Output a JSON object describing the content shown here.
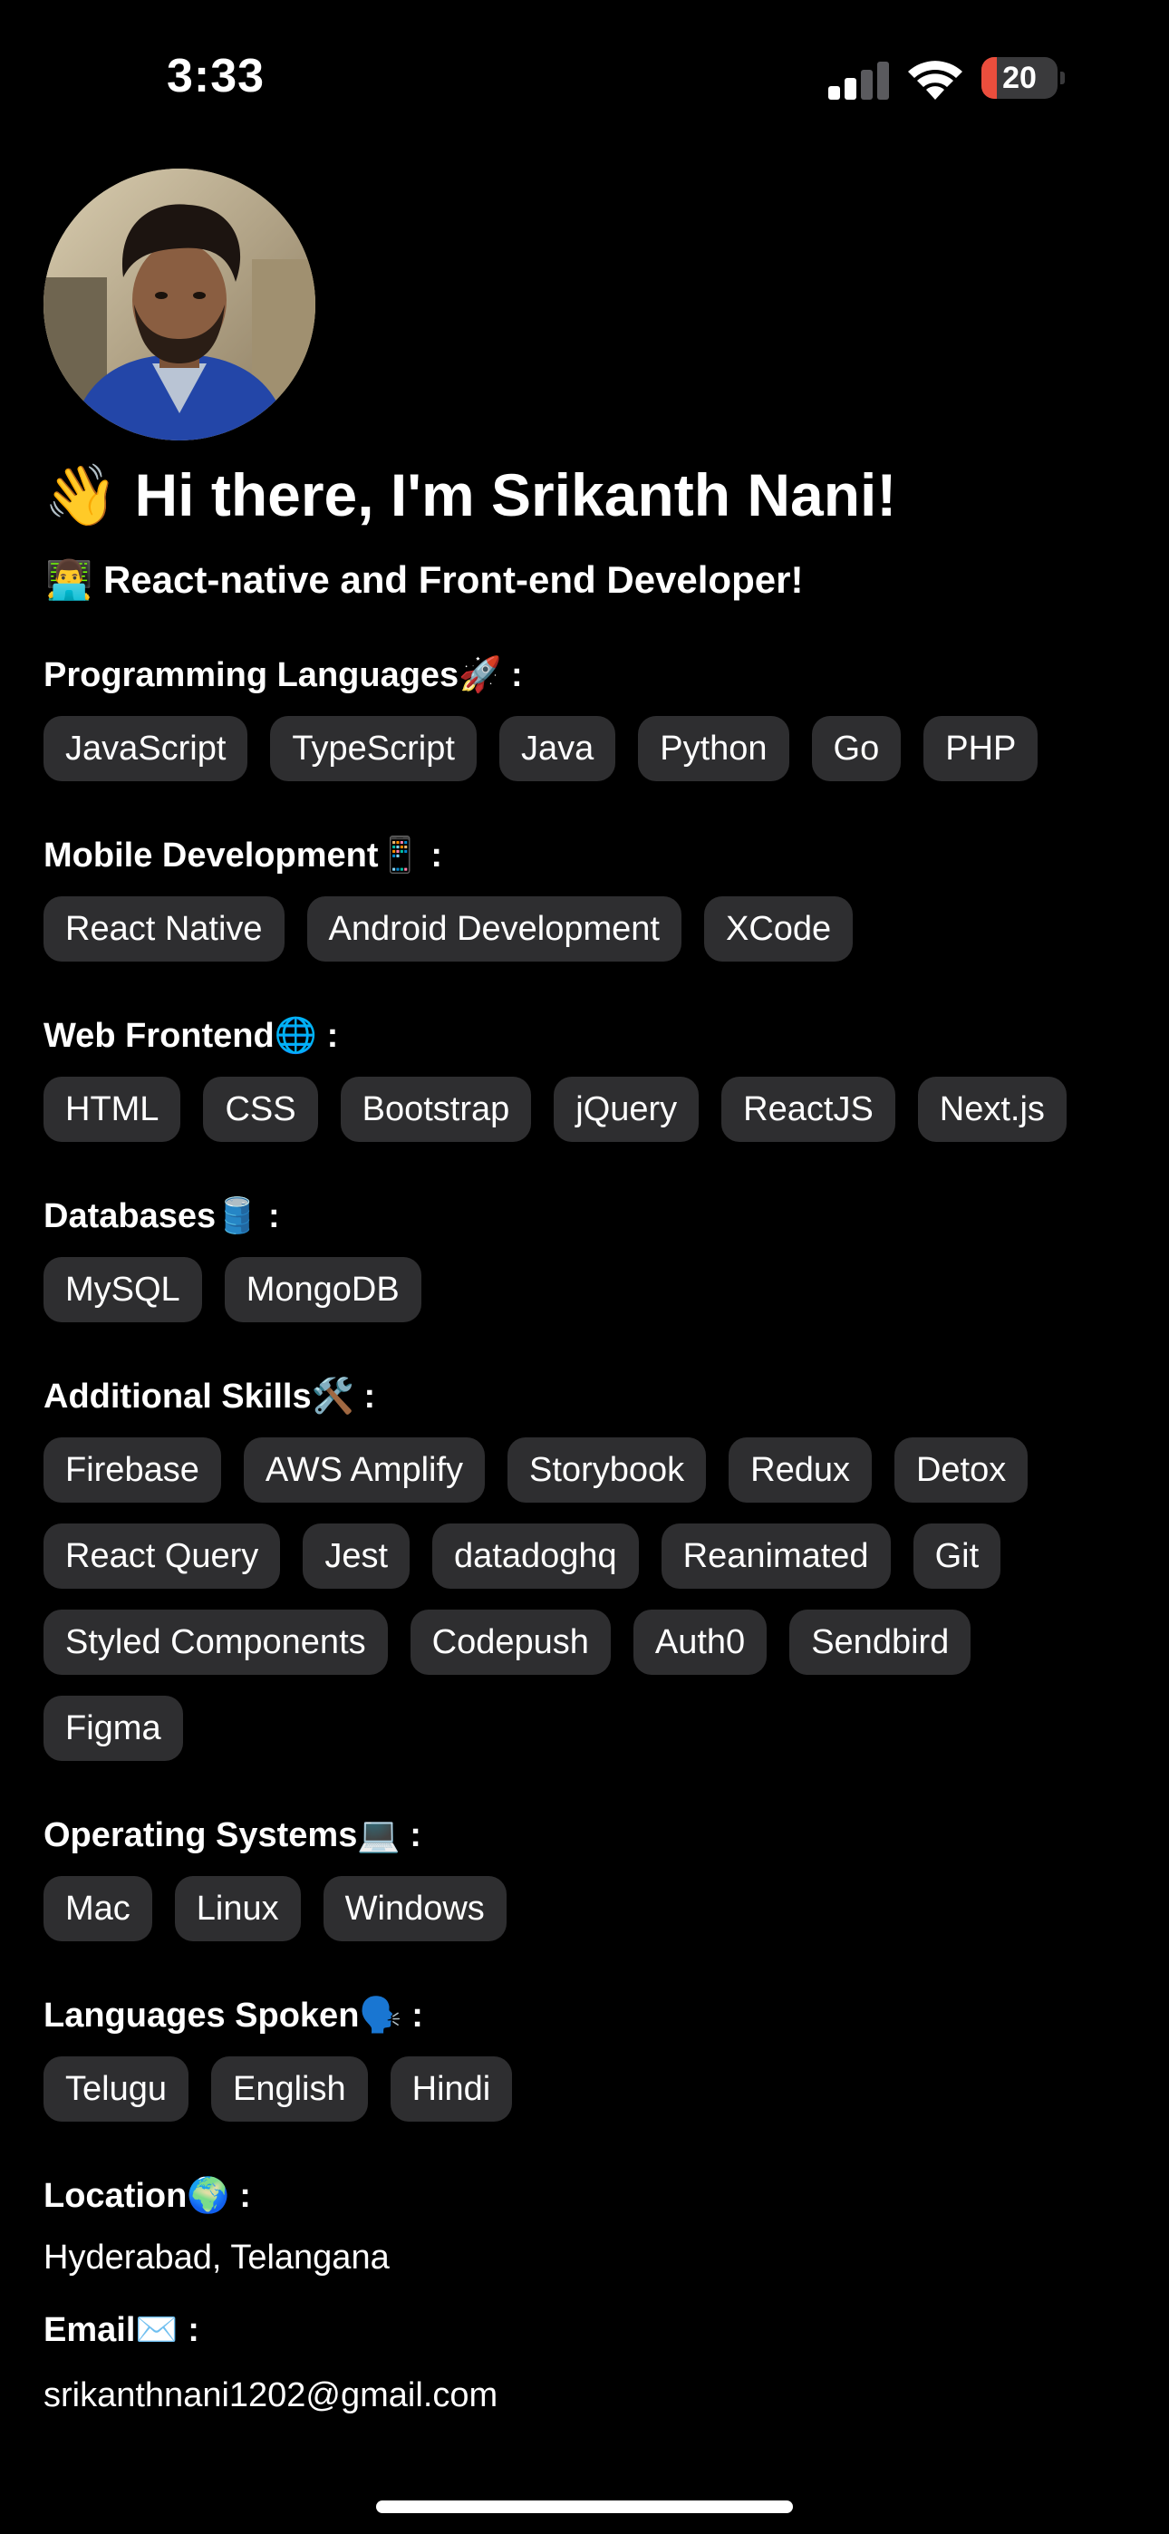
{
  "status_bar": {
    "time": "3:33",
    "battery_level": "20",
    "battery_fraction": 0.2,
    "battery_color": "#eb4e3d",
    "signal_bars_active": 2,
    "signal_bars_total": 4
  },
  "profile": {
    "greeting": "👋 Hi there, I'm Srikanth Nani!",
    "subtitle": "👨‍💻 React-native and Front-end Developer!"
  },
  "sections": [
    {
      "title": "Programming Languages🚀 :",
      "chips": [
        "JavaScript",
        "TypeScript",
        "Java",
        "Python",
        "Go",
        "PHP"
      ]
    },
    {
      "title": "Mobile Development📱 :",
      "chips": [
        "React Native",
        "Android Development",
        "XCode"
      ]
    },
    {
      "title": "Web Frontend🌐 :",
      "chips": [
        "HTML",
        "CSS",
        "Bootstrap",
        "jQuery",
        "ReactJS",
        "Next.js"
      ]
    },
    {
      "title": "Databases🛢️ :",
      "chips": [
        "MySQL",
        "MongoDB"
      ]
    },
    {
      "title": "Additional Skills🛠️ :",
      "chips": [
        "Firebase",
        "AWS Amplify",
        "Storybook",
        "Redux",
        "Detox",
        "React Query",
        "Jest",
        "datadoghq",
        "Reanimated",
        "Git",
        "Styled Components",
        "Codepush",
        "Auth0",
        "Sendbird",
        "Figma"
      ]
    },
    {
      "title": "Operating Systems💻 :",
      "chips": [
        "Mac",
        "Linux",
        "Windows"
      ]
    },
    {
      "title": "Languages Spoken🗣️ :",
      "chips": [
        "Telugu",
        "English",
        "Hindi"
      ]
    }
  ],
  "info": [
    {
      "label": "Location🌍 :",
      "value": "Hyderabad, Telangana"
    },
    {
      "label": "Email✉️ :",
      "value": "srikanthnani1202@gmail.com"
    }
  ],
  "colors": {
    "background": "#000000",
    "chip_background": "#2e2e30",
    "text": "#ffffff"
  }
}
